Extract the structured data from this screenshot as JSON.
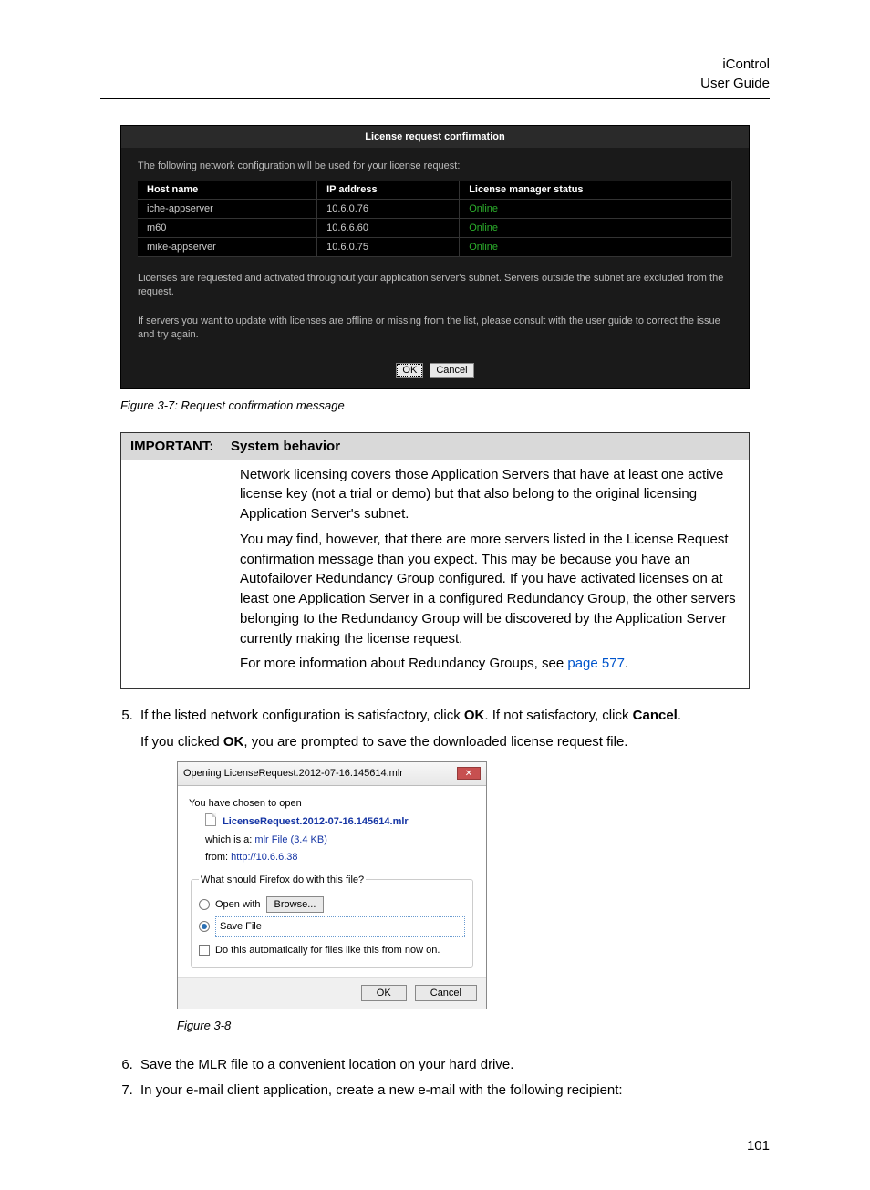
{
  "header": {
    "line1": "iControl",
    "line2": "User Guide"
  },
  "fig37": {
    "title": "License request confirmation",
    "intro": "The following network configuration will be used for your license request:",
    "columns": {
      "host": "Host name",
      "ip": "IP address",
      "status": "License manager status"
    },
    "rows": [
      {
        "host": "iche-appserver",
        "ip": "10.6.0.76",
        "status": "Online"
      },
      {
        "host": "m60",
        "ip": "10.6.6.60",
        "status": "Online"
      },
      {
        "host": "mike-appserver",
        "ip": "10.6.0.75",
        "status": "Online"
      }
    ],
    "para1": "Licenses are requested and activated throughout your application server's subnet. Servers outside the subnet are excluded from the request.",
    "para2": "If servers you want to update with licenses are offline or missing from the list, please consult with the user guide to correct the issue and try again.",
    "ok": "OK",
    "cancel": "Cancel",
    "caption": "Figure 3-7:  Request confirmation message"
  },
  "important": {
    "label": "IMPORTANT:",
    "title": "System behavior",
    "p1": "Network licensing covers those Application Servers that have at least one active license key (not a trial or demo) but that also belong to the original licensing Application Server's subnet.",
    "p2": "You may find, however, that there are more servers listed in the License Request confirmation message than you expect. This may be because you have an Autofailover Redundancy Group configured. If you have activated licenses on at least one Application Server in a configured Redundancy Group, the other servers belonging to the Redundancy Group will be discovered by the Application Server currently making the license request.",
    "p3_pre": "For more information about Redundancy Groups, see ",
    "p3_link": "page 577",
    "p3_post": "."
  },
  "steps": {
    "s5a_pre": "If the listed network configuration is satisfactory, click ",
    "s5a_ok": "OK",
    "s5a_mid": ". If not satisfactory, click ",
    "s5a_cancel": "Cancel",
    "s5a_post": ".",
    "s5b_pre": "If you clicked ",
    "s5b_ok": "OK",
    "s5b_post": ", you are prompted to save the downloaded license request file.",
    "s6": "Save the MLR file to a convenient location on your hard drive.",
    "s7": "In your e-mail client application, create a new e-mail with the following recipient:"
  },
  "fig38": {
    "title": "Opening LicenseRequest.2012-07-16.145614.mlr",
    "chosen": "You have chosen to open",
    "filename": "LicenseRequest.2012-07-16.145614.mlr",
    "which_pre": "which is a:",
    "which_val": "  mlr File (3.4 KB)",
    "from_pre": "from:",
    "from_val": "  http://10.6.6.38",
    "legend": "What should Firefox do with this file?",
    "open_with": "Open with",
    "browse": "Browse...",
    "save_file": "Save File",
    "auto": "Do this automatically for files like this from now on.",
    "ok": "OK",
    "cancel": "Cancel",
    "caption": "Figure 3-8"
  },
  "page_number": "101"
}
